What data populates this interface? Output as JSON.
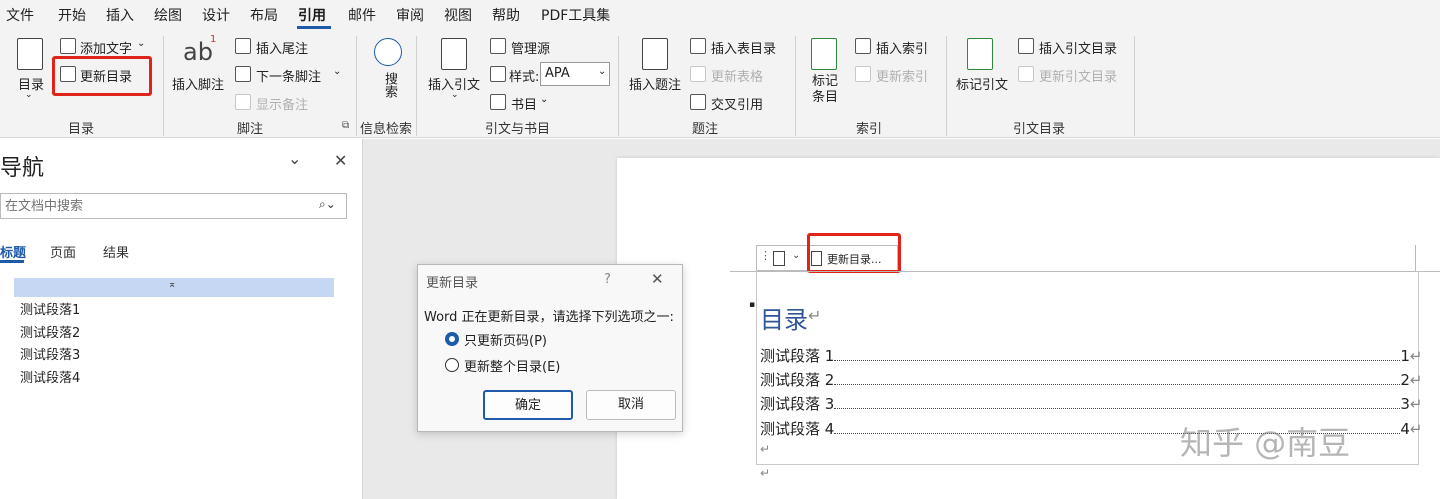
{
  "menu": {
    "items": [
      "文件",
      "开始",
      "插入",
      "绘图",
      "设计",
      "布局",
      "引用",
      "邮件",
      "审阅",
      "视图",
      "帮助",
      "PDF工具集"
    ],
    "active": "引用"
  },
  "ribbon": {
    "toc_group": {
      "toc_label": "目录",
      "add_text": "添加文字",
      "update_toc": "更新目录",
      "group": "目录"
    },
    "footnote_group": {
      "insert_footnote": "插入脚注",
      "insert_endnote": "插入尾注",
      "next_footnote": "下一条脚注",
      "show_notes": "显示备注",
      "group": "脚注",
      "ab_glyph": "ab",
      "sup": "1"
    },
    "search_group": {
      "search": "搜索",
      "group": "信息检索"
    },
    "citation_group": {
      "insert_citation": "插入引文",
      "manage_sources": "管理源",
      "style_label": "样式:",
      "style_value": "APA",
      "bibliography": "书目",
      "group": "引文与书目"
    },
    "caption_group": {
      "insert_caption": "插入题注",
      "insert_table_of_figures": "插入表目录",
      "update_table": "更新表格",
      "cross_reference": "交叉引用",
      "group": "题注"
    },
    "index_group": {
      "mark_entry": "标记条目",
      "insert_index": "插入索引",
      "update_index": "更新索引",
      "group": "索引"
    },
    "authorities_group": {
      "mark_citation": "标记引文",
      "insert_toa": "插入引文目录",
      "update_toa": "更新引文目录",
      "group": "引文目录"
    }
  },
  "nav": {
    "title": "导航",
    "search_placeholder": "在文档中搜索",
    "tabs": [
      "标题",
      "页面",
      "结果"
    ],
    "items": [
      "测试段落1",
      "测试段落2",
      "测试段落3",
      "测试段落4"
    ]
  },
  "dialog": {
    "title": "更新目录",
    "help": "?",
    "message": "Word 正在更新目录，请选择下列选项之一:",
    "option1": "只更新页码(P)",
    "option2": "更新整个目录(E)",
    "ok": "确定",
    "cancel": "取消"
  },
  "document": {
    "toc_toolbar_update": "更新目录...",
    "toc_title": "目录",
    "entries": [
      {
        "text": "测试段落 1",
        "page": "1"
      },
      {
        "text": "测试段落 2",
        "page": "2"
      },
      {
        "text": "测试段落 3",
        "page": "3"
      },
      {
        "text": "测试段落 4",
        "page": "4"
      }
    ],
    "watermark": "知乎 @南豆"
  },
  "colors": {
    "accent": "#1e5aa8",
    "highlight": "#e0241b",
    "toc_title": "#2f5597"
  }
}
